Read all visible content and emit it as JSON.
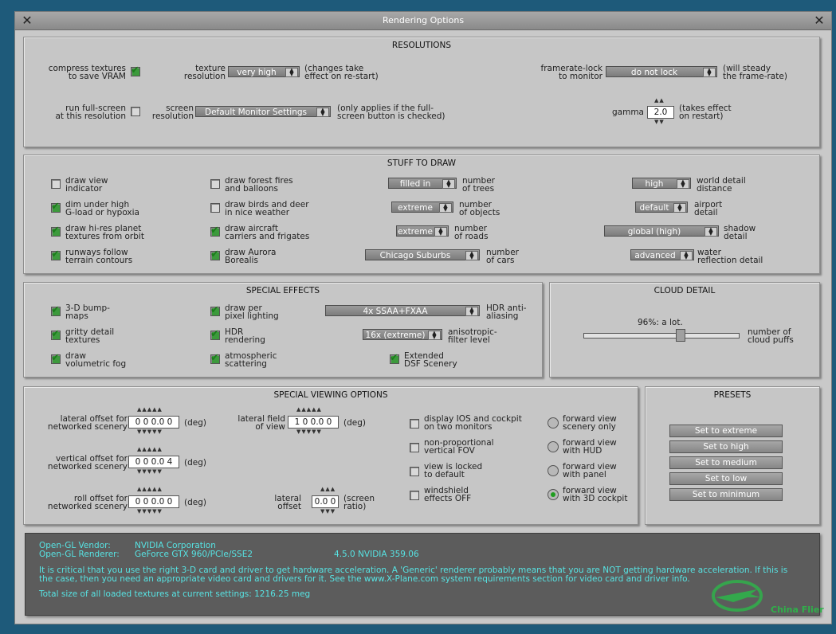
{
  "window": {
    "title": "Rendering Options"
  },
  "resolutions": {
    "header": "RESOLUTIONS",
    "compress_label": "compress textures\nto save VRAM",
    "compress_checked": true,
    "texture_label": "texture\nresolution",
    "texture_value": "very high",
    "texture_note": "(changes take\neffect on re-start)",
    "framerate_label": "framerate-lock\nto monitor",
    "framerate_value": "do not lock",
    "framerate_note": "(will steady\nthe frame-rate)",
    "fullscreen_label": "run full-screen\nat this resolution",
    "fullscreen_checked": false,
    "screen_label": "screen\nresolution",
    "screen_value": "Default Monitor Settings",
    "screen_note": "(only applies if the full-\nscreen button is checked)",
    "gamma_label": "gamma",
    "gamma_value": "2.0",
    "gamma_note": "(takes effect\non restart)"
  },
  "stuff": {
    "header": "STUFF TO DRAW",
    "checks": [
      {
        "label": "draw view\nindicator",
        "checked": false
      },
      {
        "label": "dim under high\nG-load or hypoxia",
        "checked": true
      },
      {
        "label": "draw hi-res planet\ntextures from orbit",
        "checked": true
      },
      {
        "label": "runways follow\nterrain contours",
        "checked": true
      },
      {
        "label": "draw forest fires\nand balloons",
        "checked": false
      },
      {
        "label": "draw birds and deer\nin nice weather",
        "checked": false
      },
      {
        "label": "draw aircraft\ncarriers and frigates",
        "checked": true
      },
      {
        "label": "draw Aurora\nBorealis",
        "checked": true
      }
    ],
    "trees_value": "filled in",
    "trees_label": "number\nof trees",
    "objects_value": "extreme",
    "objects_label": "number\nof objects",
    "roads_value": "extreme",
    "roads_label": "number\nof roads",
    "cars_value": "Chicago Suburbs",
    "cars_label": "number\nof cars",
    "world_value": "high",
    "world_label": "world detail\ndistance",
    "airport_value": "default",
    "airport_label": "airport\ndetail",
    "shadow_value": "global (high)",
    "shadow_label": "shadow\ndetail",
    "water_value": "advanced",
    "water_label": "water\nreflection detail"
  },
  "effects": {
    "header": "SPECIAL EFFECTS",
    "checks": [
      {
        "label": "3-D bump-\nmaps",
        "checked": true
      },
      {
        "label": "gritty detail\ntextures",
        "checked": true
      },
      {
        "label": "draw\nvolumetric fog",
        "checked": true
      },
      {
        "label": "draw per\npixel lighting",
        "checked": true
      },
      {
        "label": "HDR\nrendering",
        "checked": true
      },
      {
        "label": "atmospheric\nscattering",
        "checked": true
      },
      {
        "label": "Extended\nDSF Scenery",
        "checked": true
      }
    ],
    "aa_value": "4x SSAA+FXAA",
    "aa_label": "HDR anti-\naliasing",
    "aniso_value": "16x (extreme)",
    "aniso_label": "anisotropic-\nfilter level"
  },
  "cloud": {
    "header": "CLOUD DETAIL",
    "value_text": "96%: a lot.",
    "level": 0.96,
    "label": "number of\ncloud puffs"
  },
  "viewing": {
    "header": "SPECIAL VIEWING OPTIONS",
    "lateral_offset_label": "lateral offset for\nnetworked scenery",
    "lateral_offset_value": "0 0 0.0 0",
    "vertical_offset_label": "vertical offset for\nnetworked scenery",
    "vertical_offset_value": "0 0 0.0 4",
    "roll_offset_label": "roll offset for\nnetworked scenery",
    "roll_offset_value": "0 0 0.0 0",
    "deg": "(deg)",
    "fov_label": "lateral field\nof view",
    "fov_value": "1 0 0.0 0",
    "lat_label": "lateral\noffset",
    "lat_value": "0.0 0",
    "lat_note": "(screen\nratio)",
    "checks": [
      {
        "label": "display IOS and cockpit\non two monitors",
        "checked": false
      },
      {
        "label": "non-proportional\nvertical FOV",
        "checked": false
      },
      {
        "label": "view is locked\nto default",
        "checked": false
      },
      {
        "label": "windshield\neffects OFF",
        "checked": false
      }
    ],
    "radios": [
      {
        "label": "forward view\nscenery only",
        "selected": false
      },
      {
        "label": "forward view\nwith HUD",
        "selected": false
      },
      {
        "label": "forward view\nwith panel",
        "selected": false
      },
      {
        "label": "forward view\nwith 3D cockpit",
        "selected": true
      }
    ]
  },
  "presets": {
    "header": "PRESETS",
    "buttons": [
      "Set to extreme",
      "Set to high",
      "Set to medium",
      "Set to low",
      "Set to minimum"
    ]
  },
  "info": {
    "vendor_label": "Open-GL Vendor:",
    "vendor_value": "NVIDIA Corporation",
    "renderer_label": "Open-GL Renderer:",
    "renderer_value": "GeForce GTX 960/PCIe/SSE2",
    "version": "4.5.0 NVIDIA 359.06",
    "warning": "It is critical that you use the right 3-D card and driver to get hardware acceleration. A 'Generic' renderer probably means that you are NOT getting hardware acceleration. If this is\nthe case, then you need an appropriate video card and drivers for it. See the www.X-Plane.com system requirements section for video card and driver info.",
    "total": "Total size of all loaded textures at current settings: 1216.25 meg"
  },
  "watermark": {
    "text": "China Flier"
  }
}
